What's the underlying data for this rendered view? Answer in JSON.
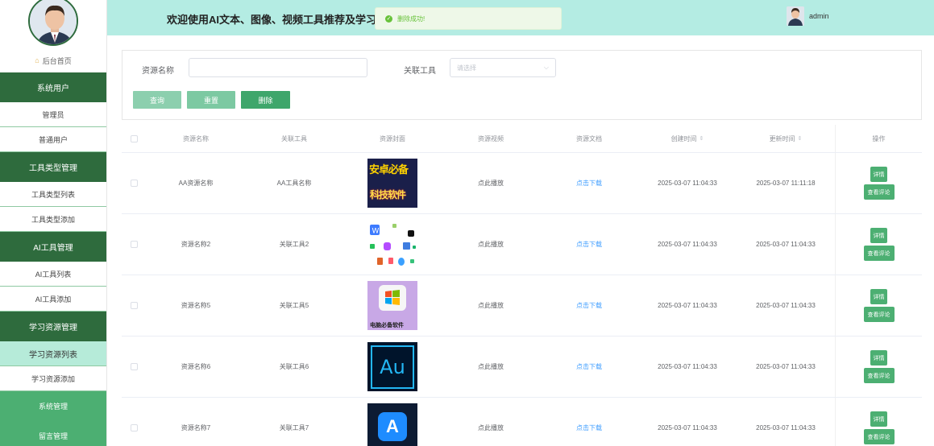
{
  "header": {
    "title": "欢迎使用AI文本、图像、视频工具推荐及学习系统",
    "toast": "删除成功!",
    "username": "admin"
  },
  "sidebar": {
    "home": "后台首页",
    "sections": [
      {
        "title": "系统用户",
        "items": [
          "管理员",
          "普通用户"
        ]
      },
      {
        "title": "工具类型管理",
        "items": [
          "工具类型列表",
          "工具类型添加"
        ]
      },
      {
        "title": "AI工具管理",
        "items": [
          "AI工具列表",
          "AI工具添加"
        ]
      },
      {
        "title": "学习资源管理",
        "items": [
          "学习资源列表",
          "学习资源添加"
        ]
      }
    ],
    "extra": [
      "系统管理",
      "留言管理"
    ]
  },
  "search": {
    "name_label": "资源名称",
    "name_value": "",
    "tool_label": "关联工具",
    "tool_placeholder": "请选择",
    "query_btn": "查询",
    "reset_btn": "重置",
    "delete_btn": "删除"
  },
  "table": {
    "headers": [
      "资源名称",
      "关联工具",
      "资源封面",
      "资源视频",
      "资源文档",
      "创建时间",
      "更新时间",
      "操作"
    ],
    "rows": [
      {
        "name": "AA资源名称",
        "tool": "AA工具名称",
        "cover": "安卓必备 科技软件",
        "video": "点此播放",
        "doc": "点击下载",
        "created": "2025-03-07 11:04:33",
        "updated": "2025-03-07 11:11:18",
        "detail": "详情",
        "review": "查看评论"
      },
      {
        "name": "资源名称2",
        "tool": "关联工具2",
        "cover": "app-icons",
        "video": "点此播放",
        "doc": "点击下载",
        "created": "2025-03-07 11:04:33",
        "updated": "2025-03-07 11:04:33",
        "detail": "详情",
        "review": "查看评论"
      },
      {
        "name": "资源名称5",
        "tool": "关联工具5",
        "cover": "电脑必备软件",
        "video": "点此播放",
        "doc": "点击下载",
        "created": "2025-03-07 11:04:33",
        "updated": "2025-03-07 11:04:33",
        "detail": "详情",
        "review": "查看评论"
      },
      {
        "name": "资源名称6",
        "tool": "关联工具6",
        "cover": "Au",
        "video": "点此播放",
        "doc": "点击下载",
        "created": "2025-03-07 11:04:33",
        "updated": "2025-03-07 11:04:33",
        "detail": "详情",
        "review": "查看评论"
      },
      {
        "name": "资源名称7",
        "tool": "关联工具7",
        "cover": "App Store",
        "video": "点此播放",
        "doc": "点击下载",
        "created": "2025-03-07 11:04:33",
        "updated": "2025-03-07 11:04:33",
        "detail": "详情",
        "review": "查看评论"
      }
    ]
  },
  "colors": {
    "sidebar_group": "#2e6b3d",
    "header_bg": "#b4ece3",
    "active_item": "#b6ebd9",
    "action_green": "#4caf72",
    "link_blue": "#409eff"
  }
}
